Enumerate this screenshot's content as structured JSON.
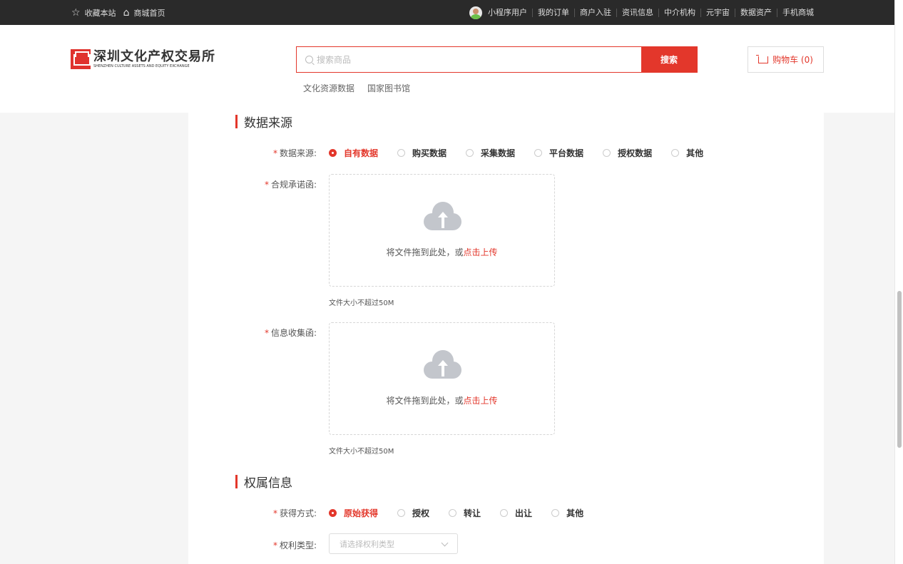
{
  "topbar": {
    "favorite": "收藏本站",
    "home": "商城首页",
    "user": "小程序用户",
    "links": [
      "我的订单",
      "商户入驻",
      "资讯信息",
      "中介机构",
      "元宇宙",
      "数据资产",
      "手机商城"
    ]
  },
  "header": {
    "logo_cn": "深圳文化产权交易所",
    "logo_en": "SHENZHEN CULTURE ASSETS AND EQUITY EXCHANGE",
    "search_placeholder": "搜索商品",
    "search_button": "搜索",
    "hotwords": [
      "文化资源数据",
      "国家图书馆"
    ],
    "cart": "购物车 (0)"
  },
  "data_source": {
    "title": "数据来源",
    "label": "数据来源:",
    "options": [
      "自有数据",
      "购买数据",
      "采集数据",
      "平台数据",
      "授权数据",
      "其他"
    ],
    "selected": "自有数据"
  },
  "compliance": {
    "label": "合规承诺函:",
    "upload_text": "将文件拖到此处，或",
    "upload_link": "点击上传",
    "tip": "文件大小不超过50M"
  },
  "collection": {
    "label": "信息收集函:",
    "upload_text": "将文件拖到此处，或",
    "upload_link": "点击上传",
    "tip": "文件大小不超过50M"
  },
  "ownership": {
    "title": "权属信息",
    "acquire_label": "获得方式:",
    "acquire_options": [
      "原始获得",
      "授权",
      "转让",
      "出让",
      "其他"
    ],
    "acquire_selected": "原始获得",
    "right_type_label": "权利类型:",
    "right_type_placeholder": "请选择权利类型"
  },
  "colors": {
    "accent": "#e3372b",
    "topbar": "#2a2a2a"
  }
}
